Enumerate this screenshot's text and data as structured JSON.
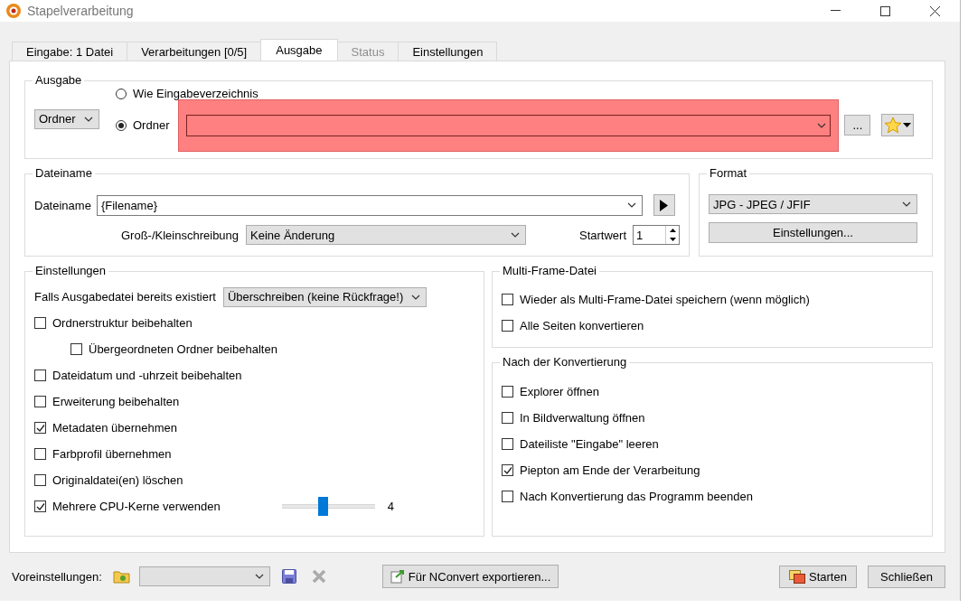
{
  "window": {
    "title": "Stapelverarbeitung"
  },
  "tabs": [
    {
      "label": "Eingabe: 1 Datei",
      "selected": false,
      "disabled": false
    },
    {
      "label": "Verarbeitungen [0/5]",
      "selected": false,
      "disabled": false
    },
    {
      "label": "Ausgabe",
      "selected": true,
      "disabled": false
    },
    {
      "label": "Status",
      "selected": false,
      "disabled": true
    },
    {
      "label": "Einstellungen",
      "selected": false,
      "disabled": false
    }
  ],
  "output": {
    "title": "Ausgabe",
    "mode": "Ordner",
    "options": [
      {
        "label": "Wie Eingabeverzeichnis",
        "selected": false
      },
      {
        "label": "Ordner",
        "selected": true
      }
    ],
    "browse_button": "..."
  },
  "filename": {
    "title": "Dateiname",
    "label": "Dateiname",
    "value": "{Filename}",
    "case_label": "Groß-/Kleinschreibung",
    "case_value": "Keine Änderung",
    "start_label": "Startwert",
    "start_value": "1"
  },
  "format": {
    "title": "Format",
    "value": "JPG - JPEG / JFIF",
    "button": "Einstellungen..."
  },
  "settings": {
    "title": "Einstellungen",
    "exists_label": "Falls Ausgabedatei bereits existiert",
    "exists_value": "Überschreiben (keine Rückfrage!)",
    "items": [
      {
        "kind": "checkbox",
        "label": "Ordnerstruktur beibehalten",
        "checked": false,
        "children": [
          {
            "label": "Übergeordneten Ordner beibehalten",
            "checked": false
          }
        ]
      },
      {
        "kind": "checkbox",
        "label": "Dateidatum und -uhrzeit beibehalten",
        "checked": false
      },
      {
        "kind": "checkbox",
        "label": "Erweiterung beibehalten",
        "checked": false
      },
      {
        "kind": "checkbox",
        "label": "Metadaten übernehmen",
        "checked": true
      },
      {
        "kind": "checkbox",
        "label": "Farbprofil übernehmen",
        "checked": false
      },
      {
        "kind": "checkbox",
        "label": "Originaldatei(en) löschen",
        "checked": false
      },
      {
        "kind": "slider",
        "label": "Mehrere CPU-Kerne verwenden",
        "checked": true,
        "level": 0.44,
        "reading": "4"
      }
    ]
  },
  "multiframe": {
    "title": "Multi-Frame-Datei",
    "items": [
      {
        "label": "Wieder als Multi-Frame-Datei speichern (wenn möglich)",
        "checked": false
      },
      {
        "label": "Alle Seiten konvertieren",
        "checked": false
      }
    ]
  },
  "after": {
    "title": "Nach der Konvertierung",
    "items": [
      {
        "label": "Explorer öffnen",
        "checked": false
      },
      {
        "label": "In Bildverwaltung öffnen",
        "checked": false
      },
      {
        "label": "Dateiliste \"Eingabe\" leeren",
        "checked": false
      },
      {
        "label": "Piepton am Ende der Verarbeitung",
        "checked": true
      },
      {
        "label": "Nach Konvertierung das Programm beenden",
        "checked": false
      }
    ]
  },
  "footer": {
    "presets_label": "Voreinstellungen:",
    "export_button": "Für NConvert exportieren...",
    "start_button": "Starten",
    "close_button": "Schließen"
  }
}
